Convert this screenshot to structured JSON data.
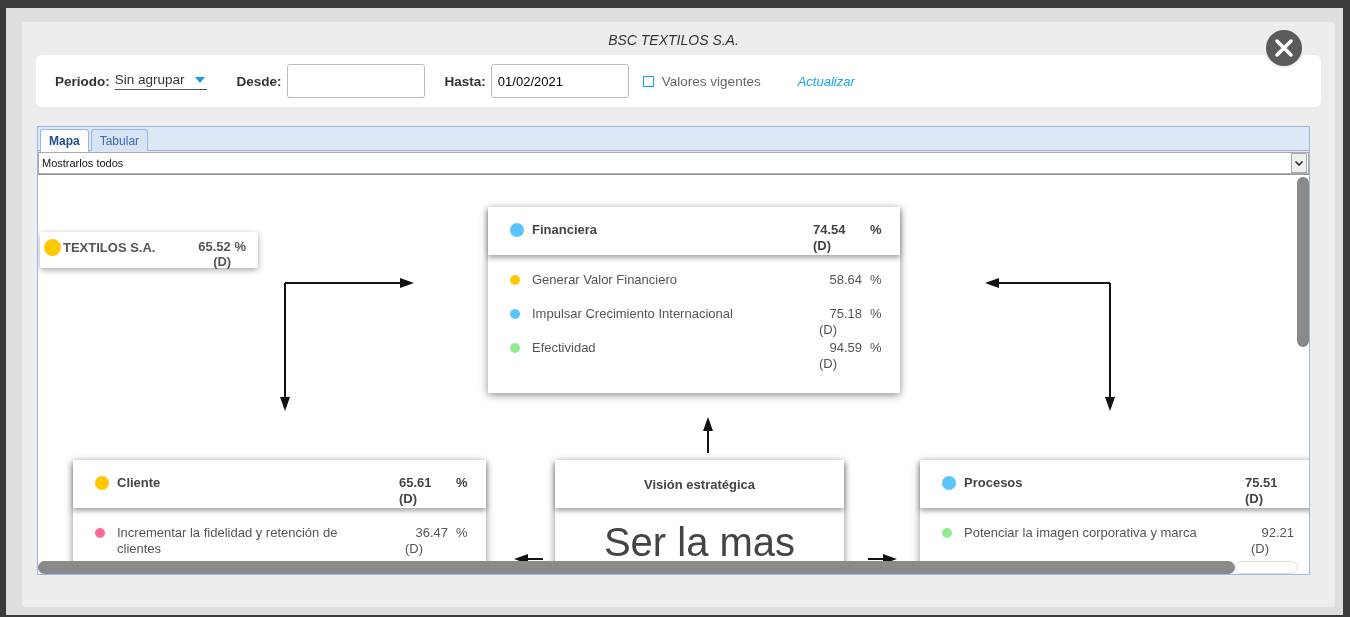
{
  "window": {
    "title": "BSC TEXTILOS S.A."
  },
  "filters": {
    "period_label": "Periodo:",
    "period_value": "Sin agrupar",
    "from_label": "Desde:",
    "to_label": "Hasta:",
    "to_value": "01/02/2021",
    "current_values": {
      "label": "Valores vigentes",
      "checked": false
    },
    "update_link": "Actualizar"
  },
  "tabs": [
    {
      "label": "Mapa",
      "selected": true
    },
    {
      "label": "Tabular",
      "selected": false
    }
  ],
  "filter_select": {
    "value": "Mostrarlos todos"
  },
  "map": {
    "root": {
      "name": "TEXTILOS S.A.",
      "value": "65.52 %",
      "note": "(D)",
      "color": "#ffc800"
    },
    "perspectives": [
      {
        "name": "Financiera",
        "value": "74.54",
        "note": "(D)",
        "unit": "%",
        "color": "#5bc4ff",
        "objectives": [
          {
            "name": "Generar Valor Financiero",
            "value": "58.64",
            "unit": "%",
            "color": "#ffc800"
          },
          {
            "name": "Impulsar Crecimiento Internacional",
            "value": "75.18",
            "note": "(D)",
            "unit": "%",
            "color": "#5bc4ff"
          },
          {
            "name": "Efectividad",
            "value": "94.59",
            "note": "(D)",
            "unit": "%",
            "color": "#90ee90"
          }
        ]
      },
      {
        "name": "Cliente",
        "value": "65.61",
        "note": "(D)",
        "unit": "%",
        "color": "#ffc800",
        "objectives": [
          {
            "name": "Incrementar la fidelidad y retención de clientes",
            "value": "36.47",
            "note": "(D)",
            "unit": "%",
            "color": "#ff6b9a"
          }
        ]
      },
      {
        "name": "Procesos",
        "value": "75.51",
        "note": "(D)",
        "color": "#5bc4ff",
        "objectives": [
          {
            "name": "Potenciar la imagen corporativa y marca",
            "value": "92.21",
            "note": "(D)",
            "color": "#90ee90"
          }
        ]
      }
    ],
    "vision": {
      "title": "Visión estratégica",
      "text": "Ser la mas"
    }
  }
}
